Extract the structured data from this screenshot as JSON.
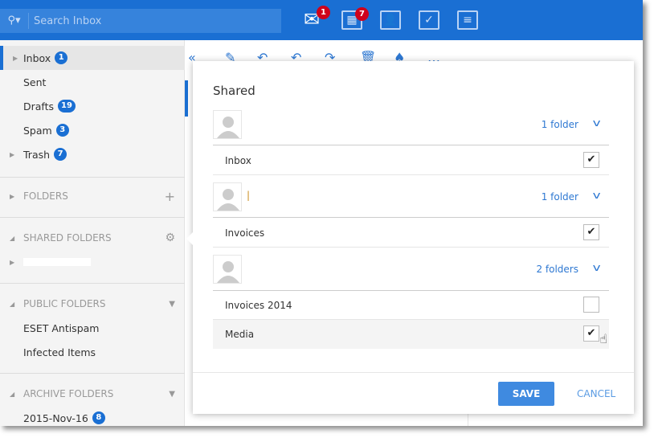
{
  "search": {
    "placeholder": "Search Inbox",
    "icon": "search-icon"
  },
  "apps": [
    {
      "name": "mail",
      "badge": "1"
    },
    {
      "name": "calendar",
      "badge": "7"
    },
    {
      "name": "contacts"
    },
    {
      "name": "tasks"
    },
    {
      "name": "notes"
    }
  ],
  "sidebar": {
    "items": [
      {
        "label": "Inbox",
        "count": "1"
      },
      {
        "label": "Sent"
      },
      {
        "label": "Drafts",
        "count": "19"
      },
      {
        "label": "Spam",
        "count": "3"
      },
      {
        "label": "Trash",
        "count": "7"
      }
    ],
    "folders": "FOLDERS",
    "shared_folders": "SHARED FOLDERS",
    "public_folders": "PUBLIC FOLDERS",
    "public_items": [
      "ESET Antispam",
      "Infected Items"
    ],
    "archive_folders": "ARCHIVE FOLDERS",
    "archive_items": [
      {
        "label": "2015-Nov-16",
        "count": "8"
      }
    ]
  },
  "dialog": {
    "title": "Shared",
    "owners": [
      {
        "count": "1 folder",
        "folders": [
          {
            "name": "Inbox",
            "checked": true
          }
        ]
      },
      {
        "count": "1 folder",
        "folders": [
          {
            "name": "Invoices",
            "checked": true
          }
        ]
      },
      {
        "count": "2 folders",
        "folders": [
          {
            "name": "Invoices 2014",
            "checked": false
          },
          {
            "name": "Media",
            "checked": true
          }
        ]
      }
    ],
    "save": "SAVE",
    "cancel": "CANCEL"
  },
  "colors": {
    "accent": "#1a6fd3",
    "badge": "#d0021b",
    "button": "#3f8ae0"
  }
}
